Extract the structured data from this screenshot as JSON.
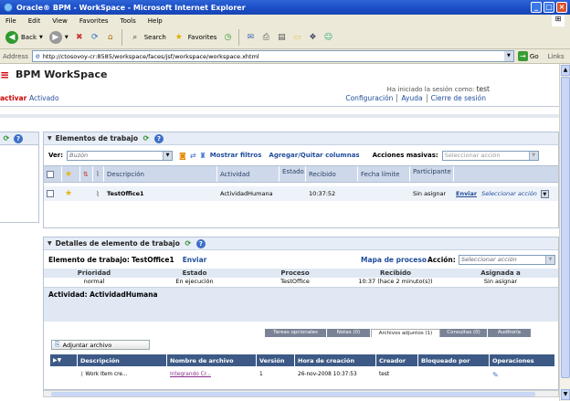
{
  "window": {
    "title": "Oracle® BPM - WorkSpace - Microsoft Internet Explorer"
  },
  "menu": [
    "File",
    "Edit",
    "View",
    "Favorites",
    "Tools",
    "Help"
  ],
  "toolbar": {
    "back": "Back",
    "search": "Search",
    "favorites": "Favorites"
  },
  "address": {
    "label": "Address",
    "url": "http://ctosovoy-cr:8585/workspace/faces/jsf/workspace/workspace.xhtml",
    "go": "Go",
    "links": "Links"
  },
  "app": {
    "title": "BPM WorkSpace",
    "activar": "activar",
    "activado": "Activado",
    "session_label": "Ha iniciado la sesión como:",
    "session_user": "test",
    "links": [
      "Configuración",
      "Ayuda",
      "Cierre de sesión"
    ]
  },
  "worklist": {
    "title": "Elementos de trabajo",
    "ver_label": "Ver:",
    "ver_value": "Buzón",
    "mostrar_filtros": "Mostrar filtros",
    "agregar_columnas": "Agregar/Quitar columnas",
    "acciones_masivas": "Acciones masivas:",
    "acciones_placeholder": "Seleccionar acción",
    "columns": [
      "Descripción",
      "Actividad",
      "Estado",
      "Recibido",
      "Fecha límite",
      "Participante"
    ],
    "rows": [
      {
        "descripcion": "TestOffice1",
        "actividad": "ActividadHumana",
        "estado": "",
        "recibido": "10:37:52",
        "fecha_limite": "",
        "participante": "Sin asignar",
        "enviar": "Enviar",
        "accion": "Seleccionar acción"
      }
    ]
  },
  "details": {
    "title": "Detalles de elemento de trabajo",
    "item_label": "Elemento de trabajo:",
    "item_name": "TestOffice1",
    "enviar": "Enviar",
    "mapa": "Mapa de proceso",
    "accion_label": "Acción:",
    "accion_placeholder": "Seleccionar acción",
    "columns": [
      "Prioridad",
      "Estado",
      "Proceso",
      "Recibido",
      "Asignada a"
    ],
    "values": [
      "normal",
      "En ejecución",
      "TestOffice",
      "10:37 (hace 2 minuto(s))",
      "Sin asignar"
    ],
    "actividad_label": "Actividad:",
    "actividad_value": "ActividadHumana",
    "tabs": [
      "Tareas opcionales",
      "Notas (0)",
      "Archivos adjuntos (1)",
      "Consultas (0)",
      "Auditoría"
    ],
    "adjuntar": "Adjuntar archivo",
    "att_columns": [
      "Descripción",
      "Nombre de archivo",
      "Versión",
      "Hora de creación",
      "Creador",
      "Bloqueado por",
      "Operaciones"
    ],
    "att_rows": [
      {
        "descripcion": "Work Item cre...",
        "archivo": "Integrando Cr...",
        "version": "1",
        "hora": "26-nov-2008 10:37:53",
        "creador": "test",
        "bloqueado": ""
      }
    ]
  }
}
